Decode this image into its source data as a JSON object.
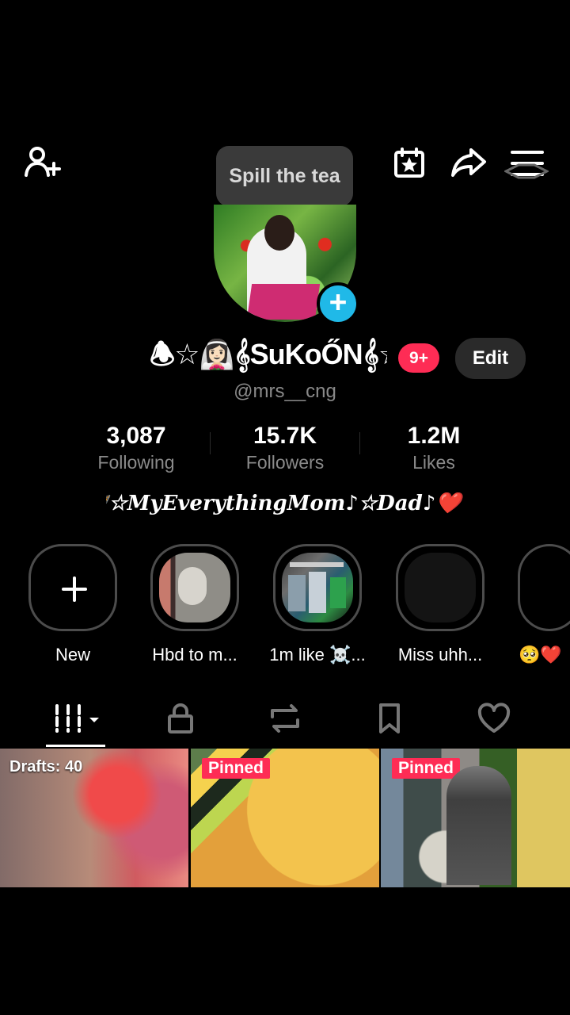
{
  "top_bar": {
    "tooltip": "Spill the tea",
    "icons": [
      "add-user-icon",
      "calendar-star-icon",
      "share-icon",
      "menu-icon"
    ]
  },
  "profile": {
    "display_name": "🕭☆👰🏻‍♀️𝄞SuKoŐN𝄞☆🕭",
    "notification_badge": "9+",
    "edit_label": "Edit",
    "handle": "@mrs__cng"
  },
  "stats": [
    {
      "value": "3,087",
      "label": "Following"
    },
    {
      "value": "15.7K",
      "label": "Followers"
    },
    {
      "value": "1.2M",
      "label": "Likes"
    }
  ],
  "bio": "🦋☆MyEverythingMom♪☆Dad♪❤️🌍",
  "highlights": [
    {
      "label": "New"
    },
    {
      "label": "Hbd to m..."
    },
    {
      "label": "1m like ☠️..."
    },
    {
      "label": "Miss uhh..."
    },
    {
      "label": "🥺❤️"
    }
  ],
  "tabs": [
    "videos",
    "private",
    "reposts",
    "saved",
    "liked"
  ],
  "grid": [
    {
      "overlay": "Drafts: 40"
    },
    {
      "overlay": "Pinned"
    },
    {
      "overlay": "Pinned"
    }
  ],
  "colors": {
    "background": "#000000",
    "accent_red": "#fe2c55",
    "accent_blue": "#20b9e8",
    "muted_text": "#8a8a8a"
  }
}
